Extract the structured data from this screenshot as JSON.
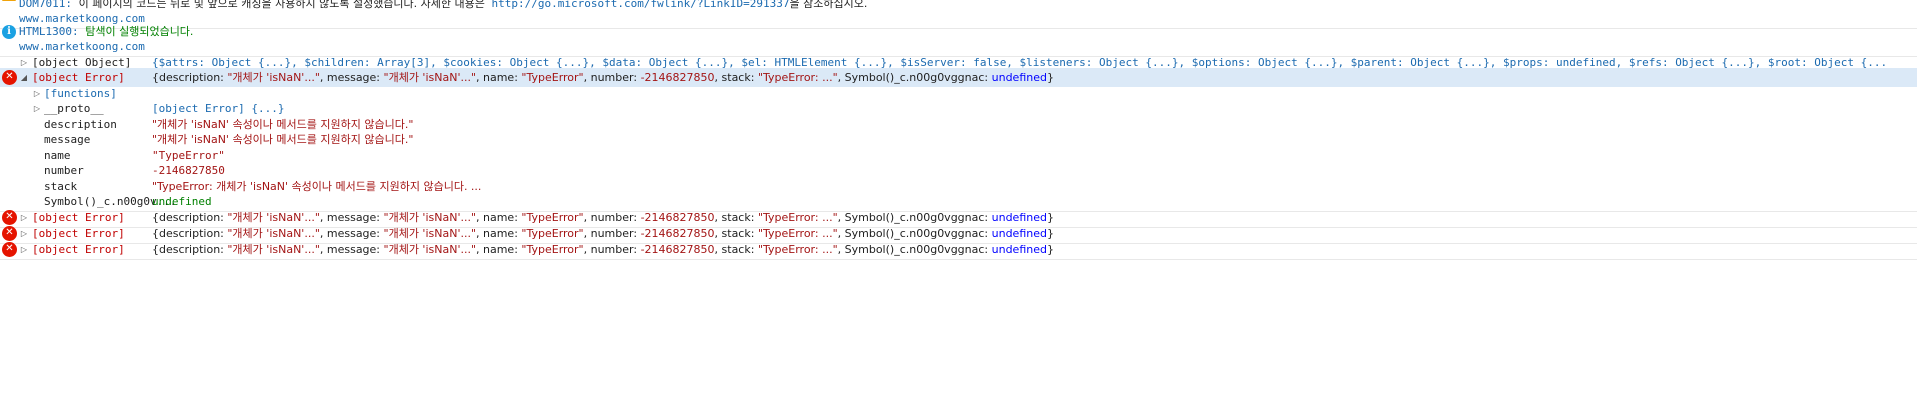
{
  "messages": {
    "dom_warning": {
      "code": "DOM7011:",
      "text": "이 페이지의 코드는 뒤로 및 앞으로 캐싱을 사용하지 않도록 설정했습니다. 자세한 내용은",
      "link": "http://go.microsoft.com/fwlink/?LinkID=291337",
      "suffix": "을 참조하십시오.",
      "source": "www.marketkoong.com"
    },
    "html_info": {
      "code": "HTML1300:",
      "text": "탐색이 실행되었습니다.",
      "source": "www.marketkoong.com"
    }
  },
  "object_row": {
    "label": "[object Object]",
    "value": "{$attrs: Object {...}, $children: Array[3], $cookies: Object {...}, $data: Object {...}, $el: HTMLElement {...}, $isServer: false, $listeners: Object {...}, $options: Object {...}, $parent: Object {...}, $props: undefined, $refs: Object {...}, $root: Object {..."
  },
  "error_summary": {
    "label": "[object Error]",
    "p1": "{description: ",
    "desc": "\"개체가 'isNaN'...\"",
    "p2": ", message: ",
    "msg": "\"개체가 'isNaN'...\"",
    "p3": ", name: ",
    "name": "\"TypeError\"",
    "p4": ", number: ",
    "number": "-2146827850",
    "p5": ", stack: ",
    "stack": "\"TypeError: ...\"",
    "p6": ", Symbol()_c.n00g0vggnac: ",
    "sym": "undefined",
    "p7": "}"
  },
  "expanded": {
    "functions_label": "[functions]",
    "proto_key": "__proto__",
    "proto_val": "[object Error] {...}",
    "props": [
      {
        "key": "description",
        "value": "\"개체가 'isNaN' 속성이나 메서드를 지원하지 않습니다.\""
      },
      {
        "key": "message",
        "value": "\"개체가 'isNaN' 속성이나 메서드를 지원하지 않습니다.\""
      },
      {
        "key": "name",
        "value": "\"TypeError\""
      },
      {
        "key": "number",
        "value": "-2146827850"
      },
      {
        "key": "stack",
        "value": "\"TypeError: 개체가 'isNaN' 속성이나 메서드를 지원하지 않습니다. ..."
      },
      {
        "key": "Symbol()_c.n00g0v...",
        "value": "undefined"
      }
    ]
  },
  "icons": {
    "error": "✕",
    "info": "i",
    "collapsed": "▷",
    "expanded": "◢"
  },
  "colors": {
    "error": "#e51400",
    "info": "#1ba1e2",
    "warning": "#f0a30a",
    "selected_row": "#dbe9f7"
  }
}
